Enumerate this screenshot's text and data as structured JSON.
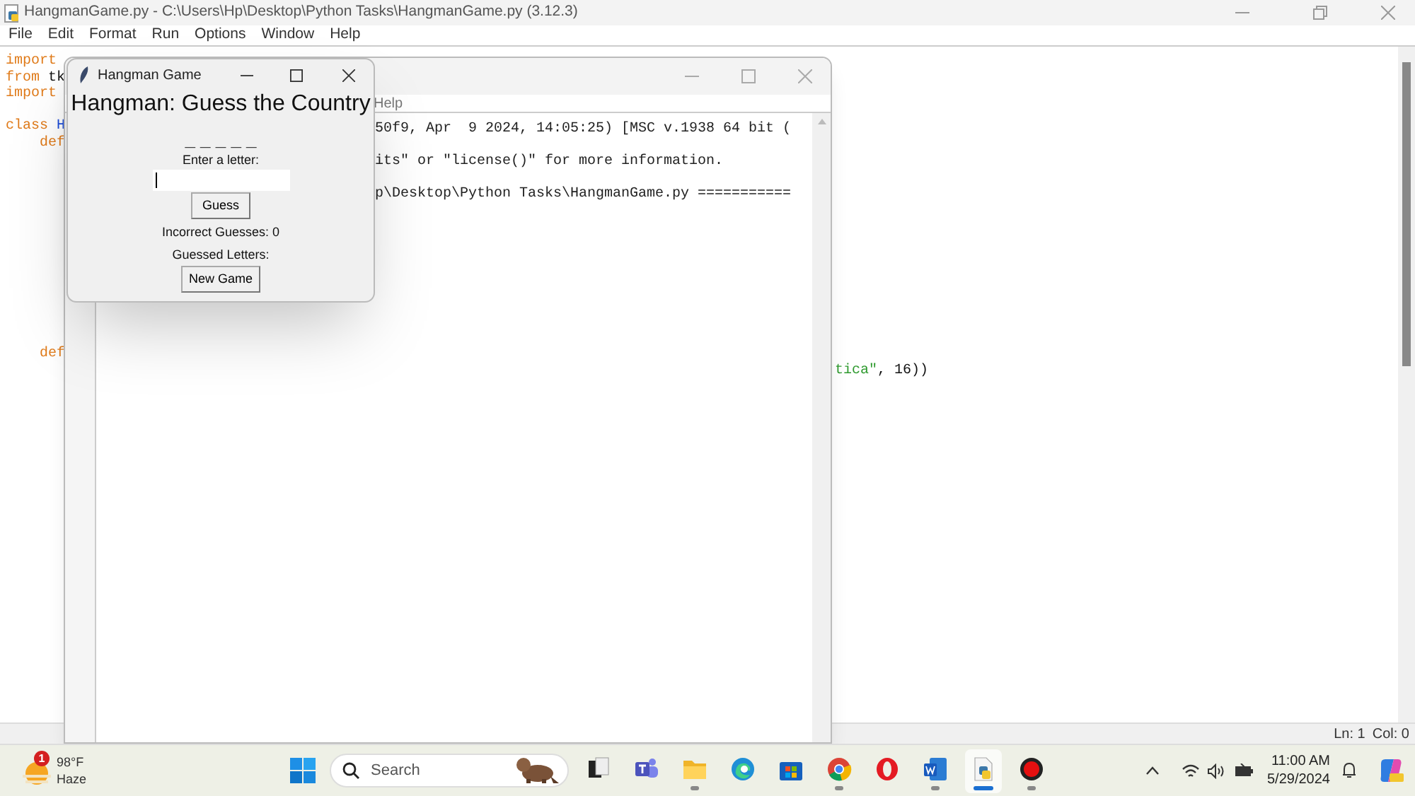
{
  "editor": {
    "title": "HangmanGame.py - C:\\Users\\Hp\\Desktop\\Python Tasks\\HangmanGame.py (3.12.3)",
    "menu": [
      "File",
      "Edit",
      "Format",
      "Run",
      "Options",
      "Window",
      "Help"
    ],
    "code_lines": [
      {
        "kind": "code",
        "tokens": [
          {
            "kind": "keyword",
            "text": "import"
          }
        ]
      },
      {
        "kind": "code",
        "tokens": [
          {
            "kind": "keyword",
            "text": "from"
          },
          {
            "kind": "plain",
            "text": " tk"
          }
        ]
      },
      {
        "kind": "code",
        "tokens": [
          {
            "kind": "keyword",
            "text": "import"
          }
        ]
      },
      {
        "kind": "blank"
      },
      {
        "kind": "code",
        "tokens": [
          {
            "kind": "keyword",
            "text": "class"
          },
          {
            "kind": "name",
            "text": " H"
          }
        ]
      },
      {
        "kind": "code",
        "tokens": [
          {
            "kind": "keyword",
            "text": "    def"
          }
        ]
      },
      {
        "kind": "blank"
      },
      {
        "kind": "blank"
      },
      {
        "kind": "blank"
      },
      {
        "kind": "blank"
      },
      {
        "kind": "blank"
      },
      {
        "kind": "blank"
      },
      {
        "kind": "blank"
      },
      {
        "kind": "blank"
      },
      {
        "kind": "blank"
      },
      {
        "kind": "blank"
      },
      {
        "kind": "blank"
      },
      {
        "kind": "blank"
      },
      {
        "kind": "code",
        "tokens": [
          {
            "kind": "keyword",
            "text": "    def"
          }
        ]
      },
      {
        "kind": "tail",
        "tokens": [
          {
            "kind": "string",
            "text": "tica\""
          },
          {
            "kind": "plain",
            "text": ", 16))"
          }
        ]
      }
    ],
    "status": {
      "line": "Ln: 1",
      "column": "Col: 0"
    }
  },
  "shell": {
    "menu": [
      "Help"
    ],
    "lines": [
      "50f9, Apr  9 2024, 14:05:25) [MSC v.1938 64 bit (",
      "its\" or \"license()\" for more information.",
      "p\\Desktop\\Python Tasks\\HangmanGame.py ==========="
    ]
  },
  "hangman": {
    "title": "Hangman Game",
    "heading": "Hangman: Guess the Country",
    "word": "_ _ _ _ _",
    "prompt": "Enter a letter:",
    "guess_button": "Guess",
    "incorrect": "Incorrect Guesses: 0",
    "guessed": "Guessed Letters:",
    "new_game_button": "New Game"
  },
  "taskbar": {
    "weather": {
      "badge": "1",
      "temperature": "98°F",
      "condition": "Haze"
    },
    "search": {
      "placeholder": "Search"
    },
    "apps": [
      {
        "kind": "task_view",
        "running": false,
        "selected": false
      },
      {
        "kind": "teams",
        "running": false,
        "selected": false
      },
      {
        "kind": "explorer",
        "running": true,
        "selected": false
      },
      {
        "kind": "edge",
        "running": false,
        "selected": false
      },
      {
        "kind": "store",
        "running": false,
        "selected": false
      },
      {
        "kind": "chrome",
        "running": true,
        "selected": false
      },
      {
        "kind": "opera",
        "running": false,
        "selected": false
      },
      {
        "kind": "word",
        "running": true,
        "selected": false
      },
      {
        "kind": "idle",
        "running": true,
        "selected": true
      },
      {
        "kind": "recorder",
        "running": true,
        "selected": false
      }
    ],
    "time": "11:00 AM",
    "date": "5/29/2024"
  }
}
